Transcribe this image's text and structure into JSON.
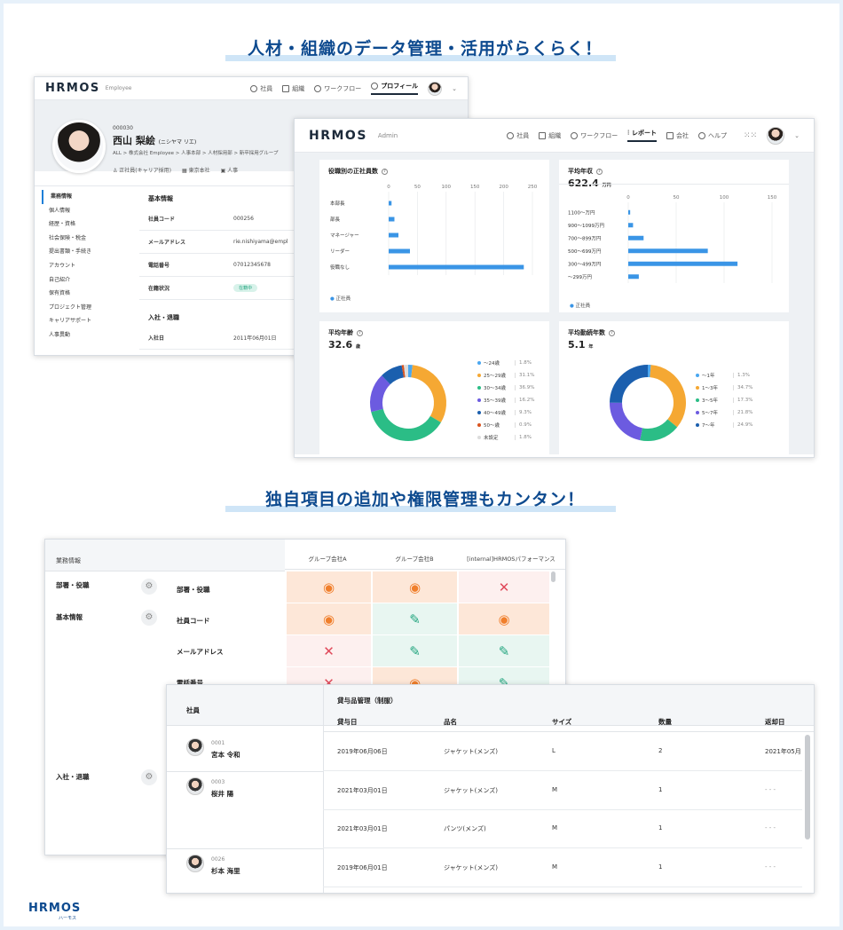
{
  "headline1": "人材・組織のデータ管理・活用がらくらく！",
  "headline2": "独自項目の追加や権限管理もカンタン！",
  "footer_logo": "HRMOS",
  "footer_logo_sub": "ハーモス",
  "employee_window": {
    "logo": "HRMOS",
    "logo_sub": "Employee",
    "nav": [
      "社員",
      "組織",
      "ワークフロー",
      "プロフィール"
    ],
    "employee_id": "000030",
    "name": "西山 梨絵",
    "name_kana": "(ニシヤマ リエ)",
    "breadcrumb": "ALL  >  株式会社 Employee  >  人事本部  >  人材採用部  >  新卒採用グループ",
    "tags": [
      "正社員(キャリア採用)",
      "東京本社",
      "人事"
    ],
    "sidebar": [
      "業務情報",
      "個人情報",
      "経歴・資格",
      "社会保険・税金",
      "提出書類・手続き",
      "アカウント",
      "自己紹介",
      "保有資格",
      "プロジェクト管理",
      "キャリアサポート",
      "人事異動"
    ],
    "section_basic": "基本情報",
    "rows": [
      {
        "key": "社員コード",
        "value": "000256"
      },
      {
        "key": "メールアドレス",
        "value": "rie.nishiyama@empl"
      },
      {
        "key": "電話番号",
        "value": "07012345678"
      },
      {
        "key": "在籍状況",
        "value": "在籍中"
      }
    ],
    "section_join": "入社・退職",
    "join_key": "入社日",
    "join_value": "2011年06月01日"
  },
  "admin_window": {
    "logo": "HRMOS",
    "logo_sub": "Admin",
    "nav": [
      "社員",
      "組織",
      "ワークフロー",
      "レポート",
      "会社",
      "ヘルプ"
    ],
    "card1_title": "役職別の正社員数",
    "card2_title": "平均年収",
    "card2_value": "622.4",
    "card2_unit": "万円",
    "card3_title": "平均年齢",
    "card3_value": "32.6",
    "card3_unit": "歳",
    "card4_title": "平均勤続年数",
    "card4_value": "5.1",
    "card4_unit": "年",
    "bar_legend": "正社員"
  },
  "chart_data": [
    {
      "type": "bar",
      "orientation": "horizontal",
      "title": "役職別の正社員数",
      "categories": [
        "本部長",
        "部長",
        "マネージャー",
        "リーダー",
        "役職なし"
      ],
      "values": [
        5,
        10,
        17,
        37,
        235
      ],
      "xlim": [
        0,
        250
      ],
      "xticks": [
        "0",
        "50",
        "100",
        "150",
        "200",
        "250"
      ],
      "series_name": "正社員",
      "color": "#3a95e6"
    },
    {
      "type": "bar",
      "orientation": "horizontal",
      "title": "平均年収",
      "categories": [
        "1100〜万円",
        "900〜1099万円",
        "700〜899万円",
        "500〜699万円",
        "300〜499万円",
        "〜299万円"
      ],
      "values": [
        2,
        5,
        16,
        83,
        114,
        11
      ],
      "xlim": [
        0,
        150
      ],
      "xticks": [
        "0",
        "50",
        "100",
        "150"
      ],
      "series_name": "正社員",
      "color": "#3a95e6"
    },
    {
      "type": "pie",
      "donut": true,
      "title": "平均年齢",
      "labels": [
        "〜24歳",
        "25〜29歳",
        "30〜34歳",
        "35〜39歳",
        "40〜49歳",
        "50〜歳",
        "未設定"
      ],
      "percent_labels": [
        "1.8%",
        "31.1%",
        "36.9%",
        "16.2%",
        "9.3%",
        "0.9%",
        "1.8%"
      ],
      "values": [
        1.8,
        31.1,
        36.9,
        16.2,
        9.3,
        0.9,
        1.8
      ],
      "colors": [
        "#4aa7f0",
        "#f5a833",
        "#2bbd86",
        "#6c5be0",
        "#1b5fae",
        "#d9531e",
        "#dcdcdc"
      ]
    },
    {
      "type": "pie",
      "donut": true,
      "title": "平均勤続年数",
      "labels": [
        "〜1年",
        "1〜3年",
        "3〜5年",
        "5〜7年",
        "7〜年"
      ],
      "percent_labels": [
        "1.3%",
        "34.7%",
        "17.3%",
        "21.8%",
        "24.9%"
      ],
      "values": [
        1.3,
        34.7,
        17.3,
        21.8,
        24.9
      ],
      "colors": [
        "#4aa7f0",
        "#f5a833",
        "#2bbd86",
        "#6c5be0",
        "#1b5fae"
      ]
    }
  ],
  "permission_window": {
    "header_left": "業務情報",
    "columns": [
      "グループ会社A",
      "グループ会社B",
      "[internal]HRMOSパフォーマンス"
    ],
    "groups": [
      "部署・役職",
      "基本情報",
      "入社・退職"
    ],
    "rows": [
      {
        "label": "部署・役職",
        "perms": [
          "view",
          "view",
          "none"
        ]
      },
      {
        "label": "社員コード",
        "perms": [
          "view",
          "edit",
          "view"
        ]
      },
      {
        "label": "メールアドレス",
        "perms": [
          "none",
          "edit",
          "edit"
        ]
      },
      {
        "label": "電話番号",
        "perms": [
          "none",
          "view",
          "edit"
        ]
      }
    ]
  },
  "lending_window": {
    "col_employee": "社員",
    "group_title": "貸与品管理（制服）",
    "headers": [
      "貸与日",
      "品名",
      "サイズ",
      "数量",
      "返却日"
    ],
    "employees": [
      {
        "id": "0001",
        "name": "宮本 令和"
      },
      {
        "id": "0003",
        "name": "桜井 陽"
      },
      {
        "id": "0026",
        "name": "杉本 海里"
      }
    ],
    "rows": [
      [
        "2019年06月06日",
        "ジャケット(メンズ)",
        "L",
        "2",
        "2021年05月"
      ],
      [
        "2021年03月01日",
        "ジャケット(メンズ)",
        "M",
        "1",
        "- - -"
      ],
      [
        "2021年03月01日",
        "パンツ(メンズ)",
        "M",
        "1",
        "- - -"
      ],
      [
        "2019年06月01日",
        "ジャケット(メンズ)",
        "M",
        "1",
        "- - -"
      ]
    ]
  }
}
